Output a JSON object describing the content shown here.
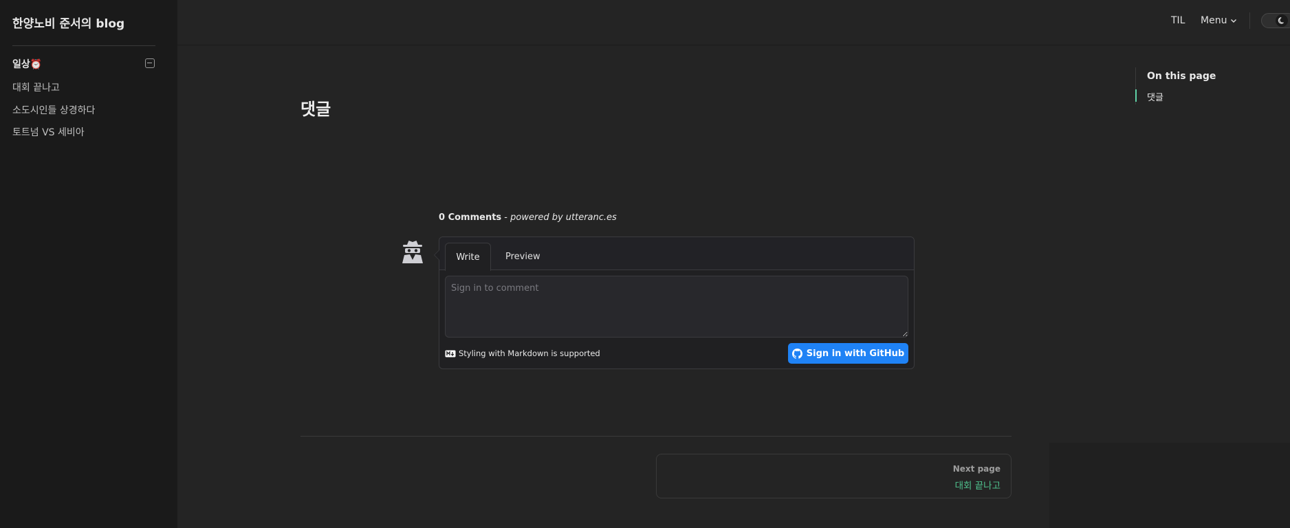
{
  "site": {
    "title": "한양노비 준서의 blog"
  },
  "sidebar": {
    "group_title": "일상⏰",
    "items": [
      {
        "label": "대회 끝나고"
      },
      {
        "label": "소도시인들 상경하다"
      },
      {
        "label": "토트넘 VS 세비아"
      }
    ]
  },
  "nav": {
    "til": "TIL",
    "menu": "Menu"
  },
  "page": {
    "heading": "댓글"
  },
  "outline": {
    "title": "On this page",
    "items": [
      {
        "label": "댓글"
      }
    ]
  },
  "comments": {
    "count": "0 Comments",
    "separator": " - ",
    "powered_by": "powered by utteranc.es",
    "tab_write": "Write",
    "tab_preview": "Preview",
    "placeholder": "Sign in to comment",
    "markdown_note": "Styling with Markdown is supported",
    "signin_button": "Sign in with GitHub"
  },
  "pager": {
    "next_label": "Next page",
    "next_title": "대회 끝나고"
  },
  "colors": {
    "accent_green": "#4fc08d",
    "github_blue": "#1f82f5",
    "background": "#242424",
    "sidebar_bg": "#1a1a1a"
  },
  "icons": [
    "chevron-down-icon",
    "moon-icon",
    "collapse-icon",
    "anonymous-avatar-icon",
    "markdown-icon",
    "github-icon"
  ]
}
